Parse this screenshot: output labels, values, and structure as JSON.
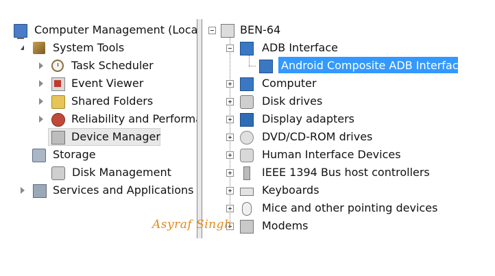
{
  "left_tree": {
    "root": "Computer Management (Local",
    "system_tools": "System Tools",
    "task_scheduler": "Task Scheduler",
    "event_viewer": "Event Viewer",
    "shared_folders": "Shared Folders",
    "reliability": "Reliability and Performa",
    "device_manager": "Device Manager",
    "storage": "Storage",
    "disk_management": "Disk Management",
    "services_apps": "Services and Applications"
  },
  "right_tree": {
    "root": "BEN-64",
    "adb_interface": "ADB Interface",
    "adb_child": "Android Composite ADB Interface",
    "computer": "Computer",
    "disk_drives": "Disk drives",
    "display_adapters": "Display adapters",
    "dvd": "DVD/CD-ROM drives",
    "hid": "Human Interface Devices",
    "ieee": "IEEE 1394 Bus host controllers",
    "keyboards": "Keyboards",
    "mice": "Mice and other pointing devices",
    "modems": "Modems"
  },
  "watermark": "Asyraf Singh",
  "colors": {
    "selection": "#3399ff",
    "watermark": "#e08a1e"
  }
}
